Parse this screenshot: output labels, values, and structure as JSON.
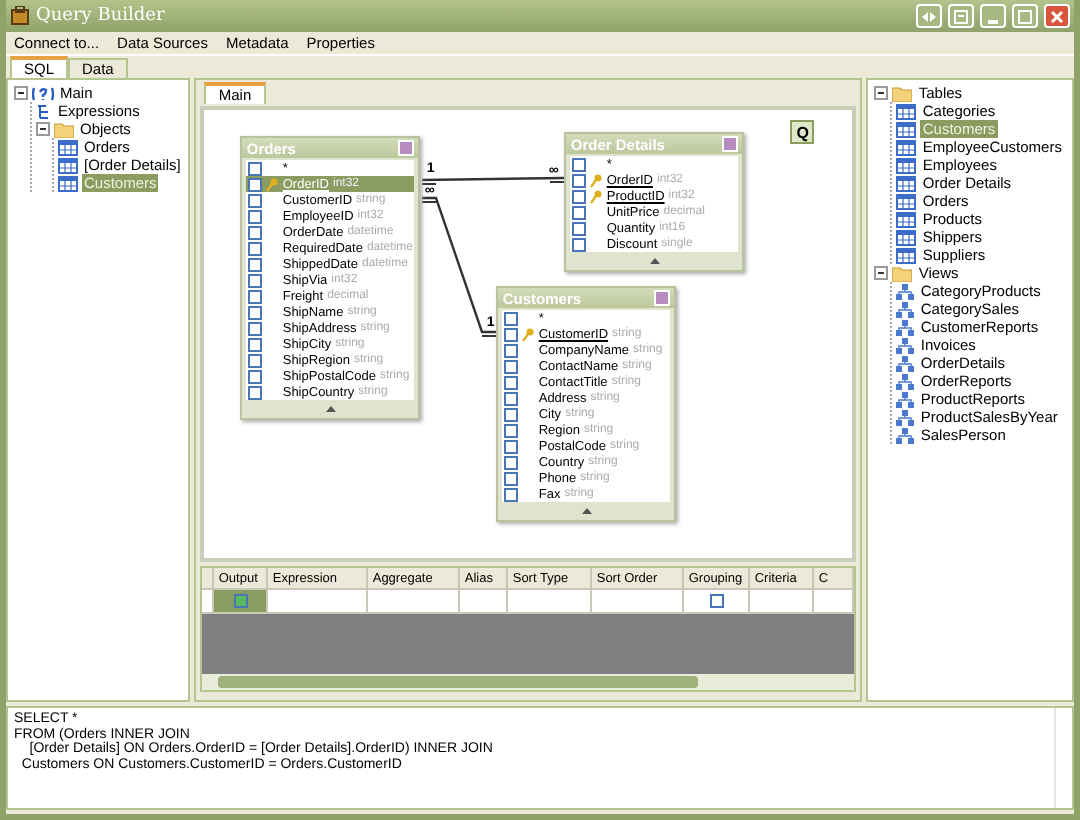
{
  "window": {
    "title": "Query Builder"
  },
  "menu": [
    "Connect to...",
    "Data Sources",
    "Metadata",
    "Properties"
  ],
  "tabs": [
    {
      "label": "SQL",
      "selected": true
    },
    {
      "label": "Data",
      "selected": false
    }
  ],
  "object_tree": [
    {
      "label": "Main",
      "kind": "root",
      "expanded": true,
      "selected": false,
      "children": [
        {
          "label": "Expressions",
          "kind": "expressions",
          "selected": false
        },
        {
          "label": "Objects",
          "kind": "folder",
          "expanded": true,
          "selected": false,
          "children": [
            {
              "label": "Orders",
              "kind": "table",
              "selected": false
            },
            {
              "label": "[Order Details]",
              "kind": "table",
              "selected": false
            },
            {
              "label": "Customers",
              "kind": "table",
              "selected": true
            }
          ]
        }
      ]
    }
  ],
  "canvas_tab": {
    "label": "Main",
    "selected": true
  },
  "diagram": {
    "query_button": "Q",
    "tables": [
      {
        "title": "Orders",
        "fields": [
          {
            "name": "*",
            "checked": false,
            "selected": false
          },
          {
            "name": "OrderID",
            "type": "int32",
            "key": true,
            "checked": false,
            "selected": true
          },
          {
            "name": "CustomerID",
            "type": "string",
            "checked": false,
            "selected": false
          },
          {
            "name": "EmployeeID",
            "type": "int32",
            "checked": false,
            "selected": false
          },
          {
            "name": "OrderDate",
            "type": "datetime",
            "checked": false,
            "selected": false
          },
          {
            "name": "RequiredDate",
            "type": "datetime",
            "checked": false,
            "selected": false
          },
          {
            "name": "ShippedDate",
            "type": "datetime",
            "checked": false,
            "selected": false
          },
          {
            "name": "ShipVia",
            "type": "int32",
            "checked": false,
            "selected": false
          },
          {
            "name": "Freight",
            "type": "decimal",
            "checked": false,
            "selected": false
          },
          {
            "name": "ShipName",
            "type": "string",
            "checked": false,
            "selected": false
          },
          {
            "name": "ShipAddress",
            "type": "string",
            "checked": false,
            "selected": false
          },
          {
            "name": "ShipCity",
            "type": "string",
            "checked": false,
            "selected": false
          },
          {
            "name": "ShipRegion",
            "type": "string",
            "checked": false,
            "selected": false
          },
          {
            "name": "ShipPostalCode",
            "type": "string",
            "checked": false,
            "selected": false
          },
          {
            "name": "ShipCountry",
            "type": "string",
            "checked": false,
            "selected": false
          }
        ]
      },
      {
        "title": "Order Details",
        "fields": [
          {
            "name": "*",
            "checked": false,
            "selected": false
          },
          {
            "name": "OrderID",
            "type": "int32",
            "key": true,
            "checked": false,
            "selected": false
          },
          {
            "name": "ProductID",
            "type": "int32",
            "key": true,
            "checked": false,
            "selected": false
          },
          {
            "name": "UnitPrice",
            "type": "decimal",
            "checked": false,
            "selected": false
          },
          {
            "name": "Quantity",
            "type": "int16",
            "checked": false,
            "selected": false
          },
          {
            "name": "Discount",
            "type": "single",
            "checked": false,
            "selected": false
          }
        ]
      },
      {
        "title": "Customers",
        "fields": [
          {
            "name": "*",
            "checked": false,
            "selected": false
          },
          {
            "name": "CustomerID",
            "type": "string",
            "key": true,
            "checked": false,
            "selected": false
          },
          {
            "name": "CompanyName",
            "type": "string",
            "checked": false,
            "selected": false
          },
          {
            "name": "ContactName",
            "type": "string",
            "checked": false,
            "selected": false
          },
          {
            "name": "ContactTitle",
            "type": "string",
            "checked": false,
            "selected": false
          },
          {
            "name": "Address",
            "type": "string",
            "checked": false,
            "selected": false
          },
          {
            "name": "City",
            "type": "string",
            "checked": false,
            "selected": false
          },
          {
            "name": "Region",
            "type": "string",
            "checked": false,
            "selected": false
          },
          {
            "name": "PostalCode",
            "type": "string",
            "checked": false,
            "selected": false
          },
          {
            "name": "Country",
            "type": "string",
            "checked": false,
            "selected": false
          },
          {
            "name": "Phone",
            "type": "string",
            "checked": false,
            "selected": false
          },
          {
            "name": "Fax",
            "type": "string",
            "checked": false,
            "selected": false
          }
        ]
      }
    ],
    "relations": [
      {
        "from_label": "1",
        "to_label": "∞"
      },
      {
        "from_label": "∞",
        "to_label": "1"
      }
    ]
  },
  "grid": {
    "columns": [
      "Output",
      "Expression",
      "Aggregate",
      "Alias",
      "Sort Type",
      "Sort Order",
      "Grouping",
      "Criteria",
      "C"
    ],
    "rows": [
      {
        "output_checked": true,
        "grouping_checked": false
      }
    ]
  },
  "database_tree": [
    {
      "label": "Tables",
      "kind": "folder",
      "expanded": true,
      "selected": false,
      "children": [
        {
          "label": "Categories",
          "kind": "table",
          "selected": false
        },
        {
          "label": "Customers",
          "kind": "table",
          "selected": true
        },
        {
          "label": "EmployeeCustomers",
          "kind": "table",
          "selected": false
        },
        {
          "label": "Employees",
          "kind": "table",
          "selected": false
        },
        {
          "label": "Order Details",
          "kind": "table",
          "selected": false
        },
        {
          "label": "Orders",
          "kind": "table",
          "selected": false
        },
        {
          "label": "Products",
          "kind": "table",
          "selected": false
        },
        {
          "label": "Shippers",
          "kind": "table",
          "selected": false
        },
        {
          "label": "Suppliers",
          "kind": "table",
          "selected": false
        }
      ]
    },
    {
      "label": "Views",
      "kind": "folder",
      "expanded": true,
      "selected": false,
      "children": [
        {
          "label": "CategoryProducts",
          "kind": "view",
          "selected": false
        },
        {
          "label": "CategorySales",
          "kind": "view",
          "selected": false
        },
        {
          "label": "CustomerReports",
          "kind": "view",
          "selected": false
        },
        {
          "label": "Invoices",
          "kind": "view",
          "selected": false
        },
        {
          "label": "OrderDetails",
          "kind": "view",
          "selected": false
        },
        {
          "label": "OrderReports",
          "kind": "view",
          "selected": false
        },
        {
          "label": "ProductReports",
          "kind": "view",
          "selected": false
        },
        {
          "label": "ProductSalesByYear",
          "kind": "view",
          "selected": false
        },
        {
          "label": "SalesPerson",
          "kind": "view",
          "selected": false
        }
      ]
    }
  ],
  "sql": [
    "SELECT *",
    "FROM (Orders INNER JOIN",
    "    [Order Details] ON Orders.OrderID = [Order Details].OrderID) INNER JOIN",
    "  Customers ON Customers.CustomerID = Orders.CustomerID"
  ]
}
